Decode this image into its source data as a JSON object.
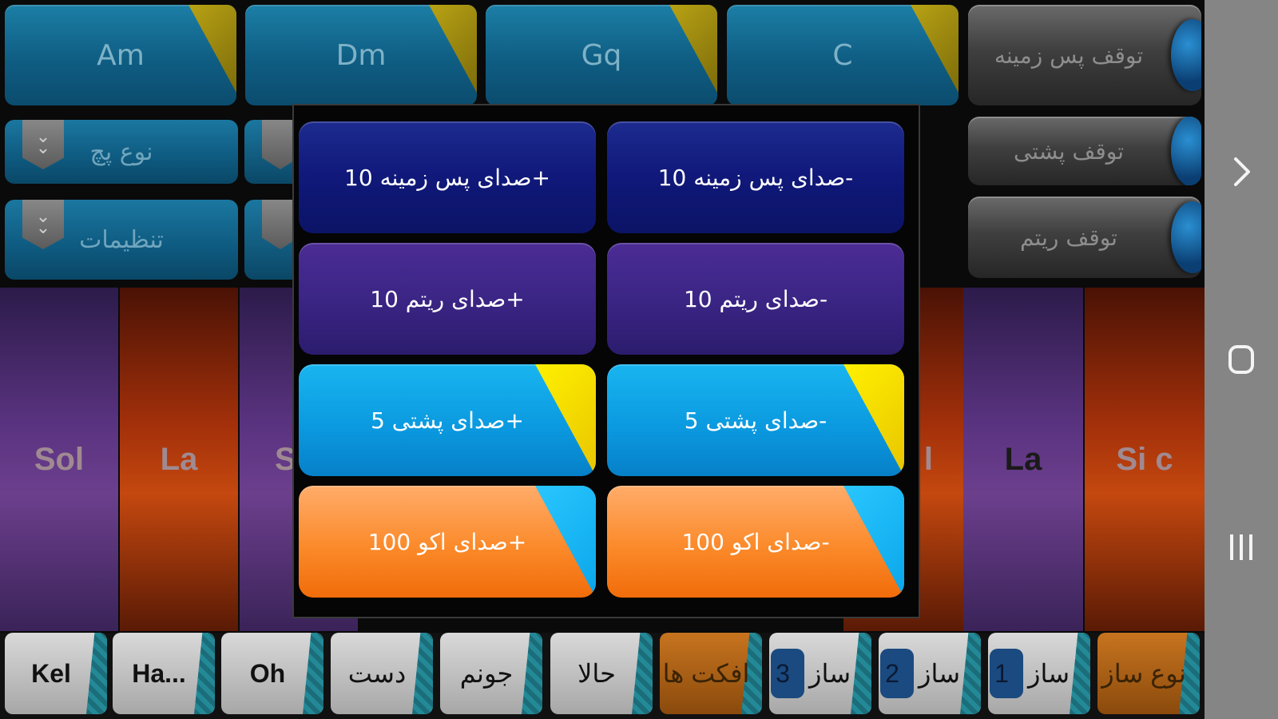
{
  "chords": [
    "Am",
    "Dm",
    "Gq",
    "C"
  ],
  "stop_buttons": [
    "توقف پس زمینه",
    "توقف پشتی",
    "توقف ریتم"
  ],
  "settings": [
    "نوع پچ",
    "تنظیمات"
  ],
  "keys": [
    "Sol",
    "La",
    "S",
    "l",
    "La",
    "Si c"
  ],
  "bottom_tabs": {
    "kel": "Kel",
    "ha": "Ha...",
    "oh": "Oh",
    "dast": "دست",
    "jonom": "جونم",
    "hala": "حالا",
    "effects": "افکت ها",
    "saz3_label": "ساز",
    "saz3_num": "3",
    "saz2_label": "ساز",
    "saz2_num": "2",
    "saz1_label": "ساز",
    "saz1_num": "1",
    "saz_type": "نوع ساز"
  },
  "modal": {
    "bg_plus": "صدای پس زمینه 10+",
    "bg_minus": "صدای پس زمینه 10-",
    "rhythm_plus": "صدای ریتم 10+",
    "rhythm_minus": "صدای ریتم 10-",
    "back_plus": "صدای پشتی 5+",
    "back_minus": "صدای پشتی 5-",
    "echo_plus": "صدای اکو 100+",
    "echo_minus": "صدای اکو 100-"
  },
  "nav_icons": [
    "chevron-right-icon",
    "home-icon",
    "recents-icon"
  ],
  "colors": {
    "chord_blue": "#0f5d83",
    "modal_navy": "#10187a",
    "modal_purple": "#3b2585",
    "modal_cyan": "#0b9ae0",
    "modal_orange": "#fb8a2a"
  }
}
